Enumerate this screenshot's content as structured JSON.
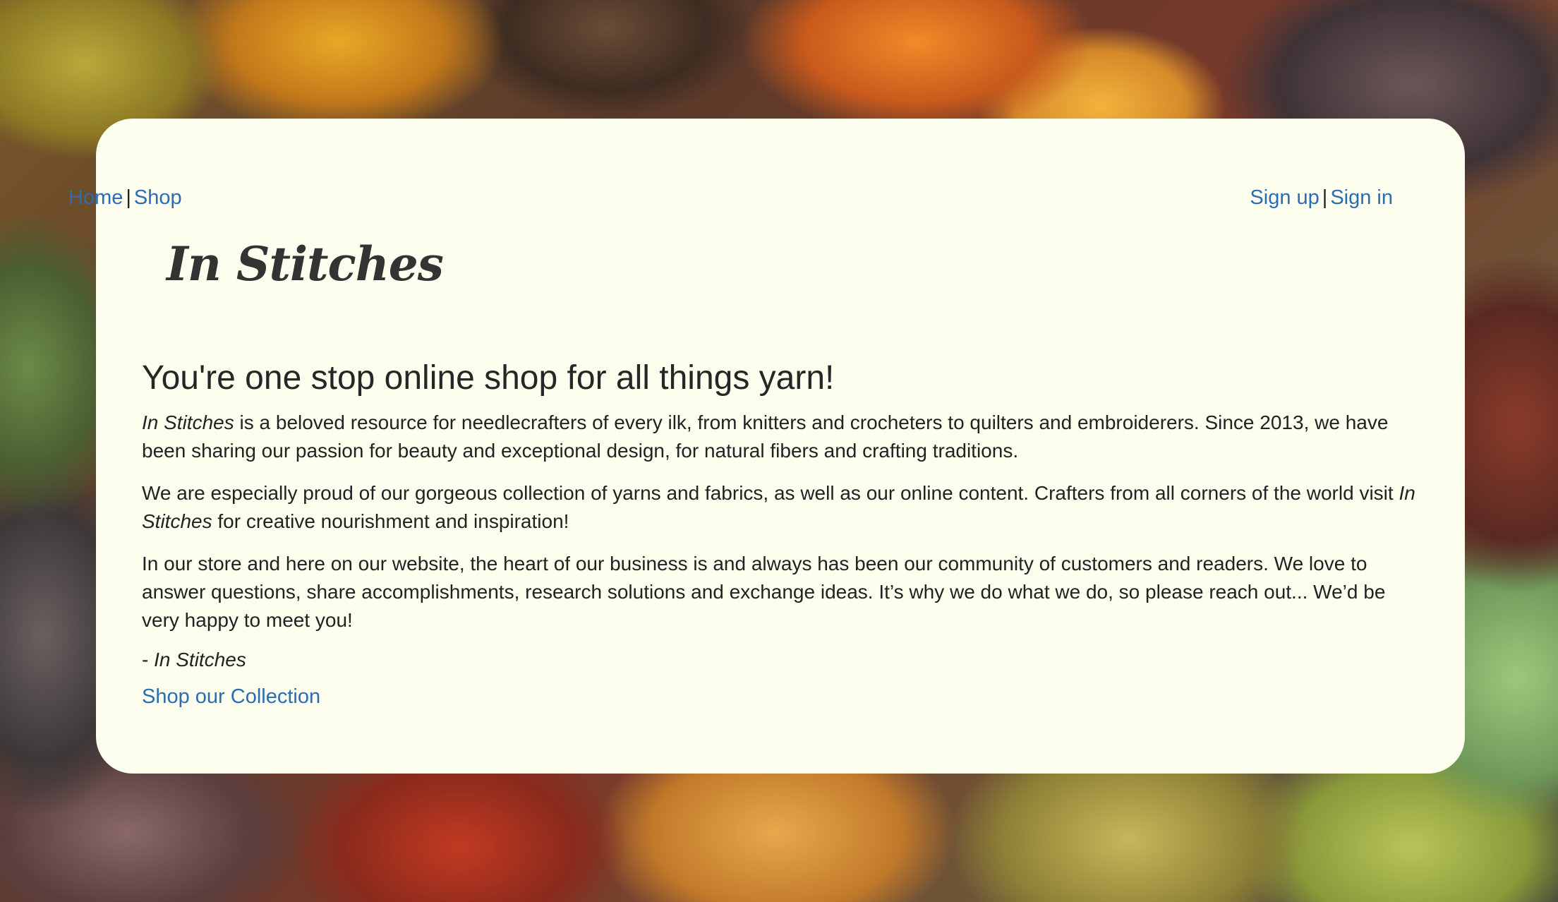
{
  "nav": {
    "home": "Home",
    "shop": "Shop",
    "sep": "|",
    "signup": "Sign up",
    "signin": "Sign in"
  },
  "brand": {
    "logo": "In Stitches"
  },
  "main": {
    "headline": "You're one stop online shop for all things yarn!",
    "p1_italic": "In Stitches",
    "p1_rest": " is a beloved resource for needlecrafters of every ilk, from knitters and crocheters to quilters and embroiderers. Since 2013, we have been sharing our passion for beauty and exceptional design, for natural fibers and crafting traditions.",
    "p2_start": "We are especially proud of our gorgeous collection of yarns and fabrics, as well as our online content. Crafters from all corners of the world visit ",
    "p2_italic": "In Stitches",
    "p2_end": " for creative nourishment and inspiration!",
    "p3": "In our store and here on our website, the heart of our business is and always has been our community of customers and readers. We love to answer questions, share accomplishments, research solutions and exchange ideas. It’s why we do what we do, so please reach out... We’d be very happy to meet you!",
    "signature_dash": "- ",
    "signature_name": "In Stitches",
    "cta": "Shop our Collection"
  },
  "colors": {
    "card": "#fdfeee",
    "link": "#2a6cb5",
    "text": "#222222"
  }
}
